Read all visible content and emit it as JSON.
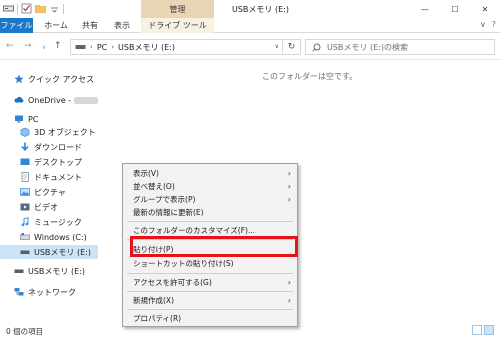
{
  "window": {
    "context_group": "管理",
    "title": "USBメモリ (E:)",
    "controls": [
      "—",
      "☐",
      "✕"
    ]
  },
  "ribbon": {
    "tabs": [
      "ファイル",
      "ホーム",
      "共有",
      "表示",
      "ドライブ ツール"
    ],
    "right_controls": [
      "∨",
      "?"
    ]
  },
  "address": {
    "nav_back": "←",
    "nav_forward": "→",
    "nav_recent": "∨",
    "nav_up": "↑",
    "crumbs": [
      "PC",
      "USBメモリ (E:)"
    ],
    "separator": "›",
    "refresh": "↻",
    "search_placeholder": "USBメモリ (E:)の検索"
  },
  "nav_pane": {
    "items": [
      {
        "label": "クイック アクセス",
        "icon": "star-icon",
        "color": "#2f7fd0"
      },
      {
        "label": "OneDrive -",
        "icon": "cloud-icon",
        "color": "#1e6ec8"
      },
      {
        "label": "PC",
        "icon": "pc-icon",
        "color": "#2f86d3"
      },
      {
        "label": "3D オブジェクト",
        "icon": "cube-icon",
        "color": "#3f8fd8"
      },
      {
        "label": "ダウンロード",
        "icon": "download-icon",
        "color": "#2f7fd0"
      },
      {
        "label": "デスクトップ",
        "icon": "desktop-icon",
        "color": "#2f86d3"
      },
      {
        "label": "ドキュメント",
        "icon": "document-icon",
        "color": "#7c8aa0"
      },
      {
        "label": "ピクチャ",
        "icon": "picture-icon",
        "color": "#3c8fd6"
      },
      {
        "label": "ビデオ",
        "icon": "video-icon",
        "color": "#5a6a86"
      },
      {
        "label": "ミュージック",
        "icon": "music-icon",
        "color": "#3f8fd8"
      },
      {
        "label": "Windows (C:)",
        "icon": "drive-icon",
        "color": "#7d8792"
      },
      {
        "label": "USBメモリ (E:)",
        "icon": "usb-drive-icon",
        "color": "#555d66"
      },
      {
        "label": "USBメモリ (E:)",
        "icon": "usb-drive-icon",
        "color": "#555d66"
      },
      {
        "label": "ネットワーク",
        "icon": "network-icon",
        "color": "#2f86d3"
      }
    ]
  },
  "content": {
    "empty_message": "このフォルダーは空です。"
  },
  "context_menu": {
    "items": [
      {
        "label": "表示(V)",
        "submenu": true
      },
      {
        "label": "並べ替え(O)",
        "submenu": true
      },
      {
        "label": "グループで表示(P)",
        "submenu": true
      },
      {
        "label": "最新の情報に更新(E)",
        "submenu": false
      },
      {
        "label": "このフォルダーのカスタマイズ(F)...",
        "submenu": false
      },
      {
        "label": "貼り付け(P)",
        "submenu": false,
        "highlighted": true
      },
      {
        "label": "ショートカットの貼り付け(S)",
        "submenu": false
      },
      {
        "label": "アクセスを許可する(G)",
        "submenu": true
      },
      {
        "label": "新規作成(X)",
        "submenu": true
      },
      {
        "label": "プロパティ(R)",
        "submenu": false
      }
    ],
    "arrow": "›",
    "highlight_color": "#e8131a"
  },
  "status": {
    "item_count": "0 個の項目"
  },
  "colors": {
    "accent": "#1979ca",
    "context_tab": "#e9d5b4",
    "selection": "#cce4f7"
  }
}
